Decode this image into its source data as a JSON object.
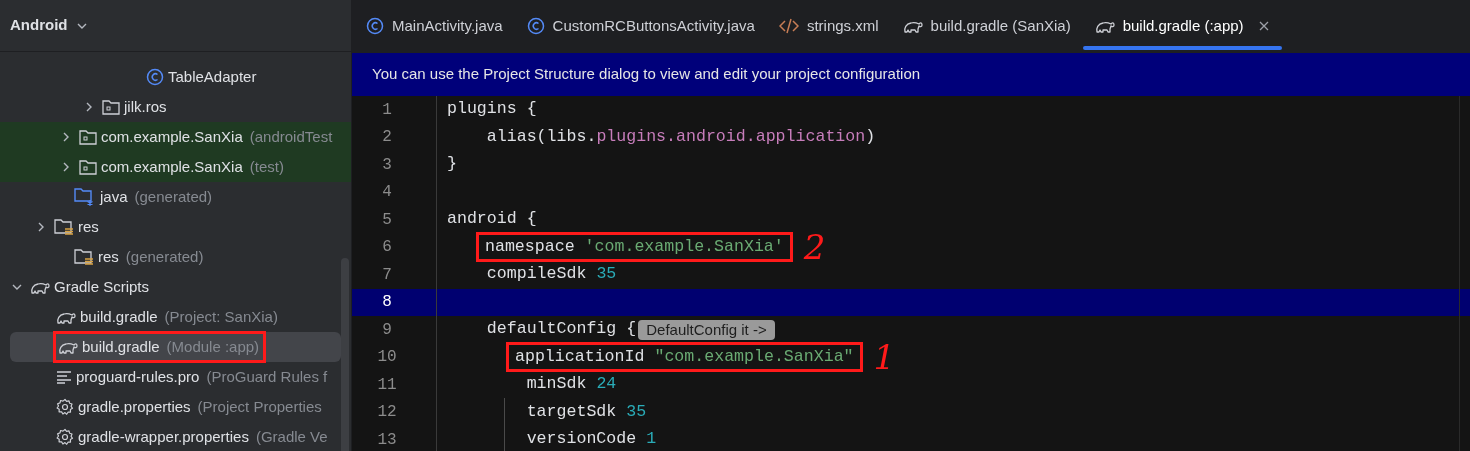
{
  "sidebar": {
    "title": "Android",
    "tree": [
      {
        "label": "TableAdapter",
        "kind": "class"
      },
      {
        "label": "jilk.ros",
        "kind": "package",
        "expanded": false
      },
      {
        "label": "com.example.SanXia",
        "note": "(androidTest",
        "kind": "package",
        "expanded": false,
        "test_source": true
      },
      {
        "label": "com.example.SanXia",
        "note": "(test)",
        "kind": "package",
        "expanded": false,
        "test_source": true
      },
      {
        "label": "java",
        "note": "(generated)",
        "kind": "generated-folder"
      },
      {
        "label": "res",
        "kind": "res-folder",
        "expanded": false
      },
      {
        "label": "res",
        "note": "(generated)",
        "kind": "res-folder"
      },
      {
        "label": "Gradle Scripts",
        "kind": "gradle",
        "expanded": true,
        "children": [
          {
            "label": "build.gradle",
            "note": "(Project: SanXia)",
            "kind": "gradle",
            "selected": false,
            "boxed": false
          },
          {
            "label": "build.gradle",
            "note": "(Module :app)",
            "kind": "gradle",
            "selected": true,
            "boxed": true
          },
          {
            "label": "proguard-rules.pro",
            "note": "(ProGuard Rules f",
            "kind": "text",
            "selected": false,
            "boxed": false
          },
          {
            "label": "gradle.properties",
            "note": "(Project Properties",
            "kind": "settings",
            "selected": false,
            "boxed": false
          },
          {
            "label": "gradle-wrapper.properties",
            "note": "(Gradle Ve",
            "kind": "settings",
            "selected": false,
            "boxed": false
          }
        ]
      }
    ]
  },
  "tabs": [
    {
      "label": "MainActivity.java",
      "kind": "class",
      "selected": false
    },
    {
      "label": "CustomRCButtonsActivity.java",
      "kind": "class",
      "selected": false
    },
    {
      "label": "strings.xml",
      "kind": "xml",
      "selected": false
    },
    {
      "label": "build.gradle (SanXia)",
      "kind": "gradle",
      "selected": false
    },
    {
      "label": "build.gradle (:app)",
      "kind": "gradle",
      "selected": true
    }
  ],
  "banner": "You can use the Project Structure dialog to view and edit your project configuration",
  "editor": {
    "lines": [
      {
        "number": "1",
        "current": false,
        "segments": [
          {
            "text": "plugins {",
            "kind": "plain"
          }
        ]
      },
      {
        "number": "2",
        "current": false,
        "segments": [
          {
            "text": "    alias(libs.",
            "kind": "plain"
          },
          {
            "text": "plugins.android.application",
            "kind": "property"
          },
          {
            "text": ")",
            "kind": "plain"
          }
        ]
      },
      {
        "number": "3",
        "current": false,
        "segments": [
          {
            "text": "}",
            "kind": "plain"
          }
        ]
      },
      {
        "number": "4",
        "current": false
      },
      {
        "number": "5",
        "current": false,
        "segments": [
          {
            "text": "android {",
            "kind": "plain"
          }
        ]
      },
      {
        "number": "6",
        "current": false,
        "boxed": true,
        "annotation": "2",
        "segments": [
          {
            "text": "namespace ",
            "kind": "plain"
          },
          {
            "text": "'com.example.SanXia'",
            "kind": "string"
          }
        ]
      },
      {
        "number": "7",
        "current": false,
        "segments": [
          {
            "text": "    compileSdk ",
            "kind": "plain"
          },
          {
            "text": "35",
            "kind": "number"
          }
        ]
      },
      {
        "number": "8",
        "current": true
      },
      {
        "number": "9",
        "current": false,
        "segments": [
          {
            "text": "    defaultConfig {",
            "kind": "plain"
          },
          {
            "text": "DefaultConfig it ->",
            "kind": "hint"
          }
        ]
      },
      {
        "number": "10",
        "current": false,
        "boxed": true,
        "annotation": "1",
        "segments": [
          {
            "text": "applicationId ",
            "kind": "plain"
          },
          {
            "text": "\"com.example.SanXia\"",
            "kind": "string"
          }
        ]
      },
      {
        "number": "11",
        "current": false,
        "segments": [
          {
            "text": "        minSdk ",
            "kind": "plain"
          },
          {
            "text": "24",
            "kind": "number"
          }
        ]
      },
      {
        "number": "12",
        "current": false,
        "segments": [
          {
            "text": "        targetSdk ",
            "kind": "plain"
          },
          {
            "text": "35",
            "kind": "number"
          }
        ]
      },
      {
        "number": "13",
        "current": false,
        "segments": [
          {
            "text": "        versionCode ",
            "kind": "plain"
          },
          {
            "text": "1",
            "kind": "number"
          }
        ]
      }
    ]
  }
}
